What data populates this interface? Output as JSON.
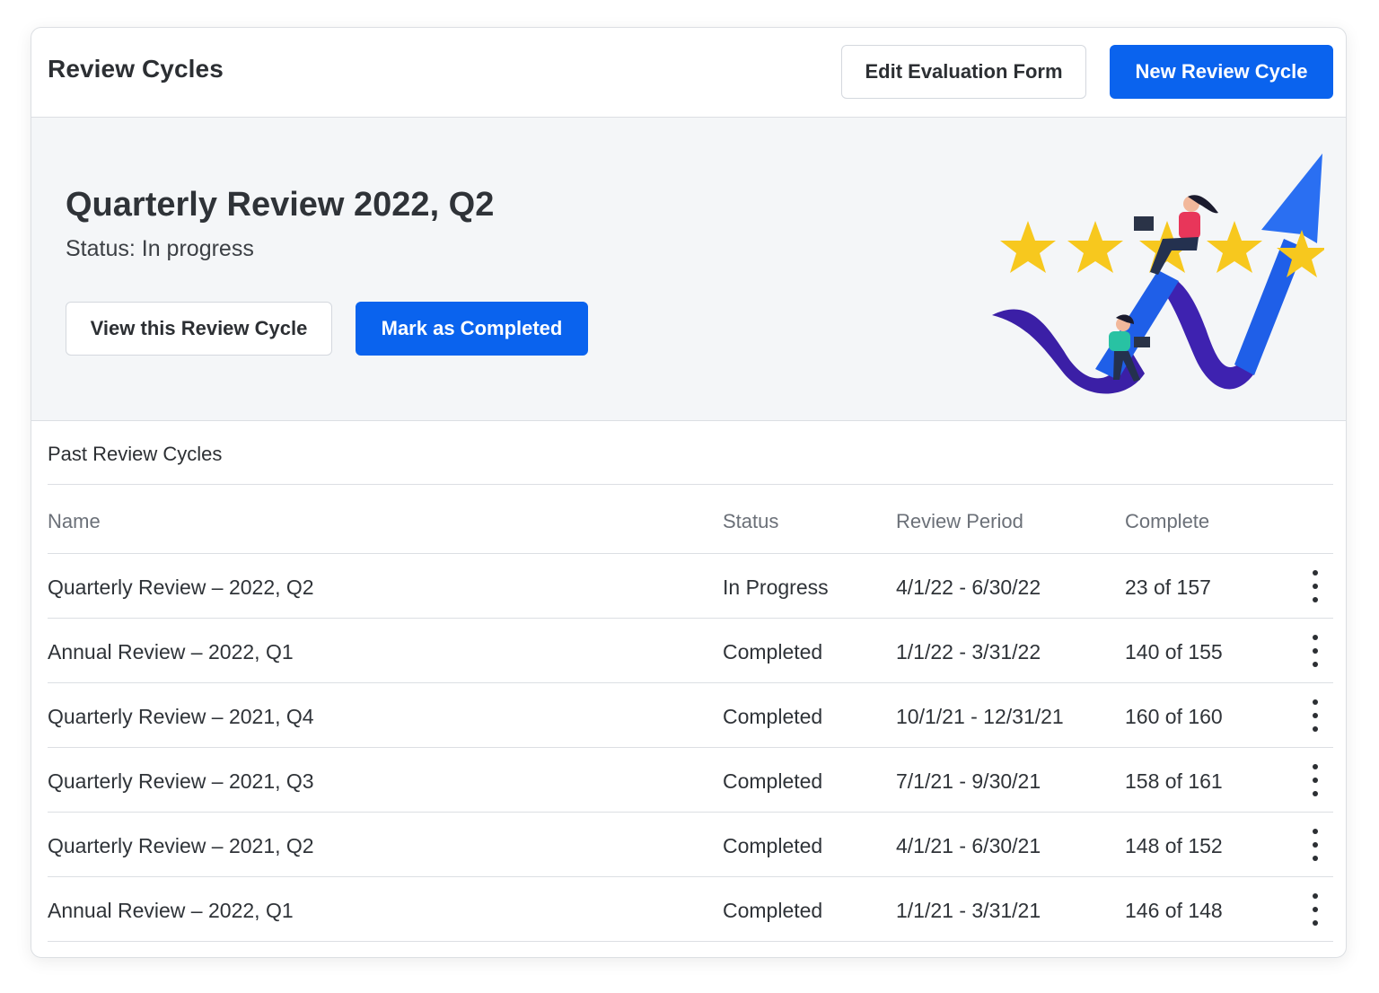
{
  "header": {
    "title": "Review Cycles",
    "edit_form_label": "Edit Evaluation Form",
    "new_cycle_label": "New Review Cycle"
  },
  "current_cycle": {
    "title": "Quarterly Review 2022, Q2",
    "status": "Status: In progress",
    "view_label": "View this Review Cycle",
    "complete_label": "Mark as Completed"
  },
  "past": {
    "section_title": "Past Review Cycles",
    "columns": [
      "Name",
      "Status",
      "Review Period",
      "Complete"
    ],
    "rows": [
      {
        "name": "Quarterly Review – 2022, Q2",
        "status": "In Progress",
        "period": "4/1/22 - 6/30/22",
        "complete": "23 of 157"
      },
      {
        "name": "Annual Review – 2022, Q1",
        "status": "Completed",
        "period": "1/1/22 - 3/31/22",
        "complete": "140 of 155"
      },
      {
        "name": "Quarterly Review – 2021, Q4",
        "status": "Completed",
        "period": "10/1/21 - 12/31/21",
        "complete": "160 of 160"
      },
      {
        "name": "Quarterly Review – 2021, Q3",
        "status": "Completed",
        "period": "7/1/21 - 9/30/21",
        "complete": "158 of 161"
      },
      {
        "name": "Quarterly Review – 2021, Q2",
        "status": "Completed",
        "period": "4/1/21 - 6/30/21",
        "complete": "148 of 152"
      },
      {
        "name": "Annual Review – 2022, Q1",
        "status": "Completed",
        "period": "1/1/21 - 3/31/21",
        "complete": "146 of 148"
      }
    ]
  },
  "colors": {
    "primary": "#0a63ee",
    "border": "#dcdfe3",
    "hero_bg": "#f4f6f8",
    "star": "#f7c81e",
    "ribbon_purple": "#3b1fa6",
    "arrow_blue": "#1f5fe8"
  },
  "icons": {
    "row_menu": "more-vertical-icon",
    "illustration": "growth-arrow-stars-illustration"
  }
}
